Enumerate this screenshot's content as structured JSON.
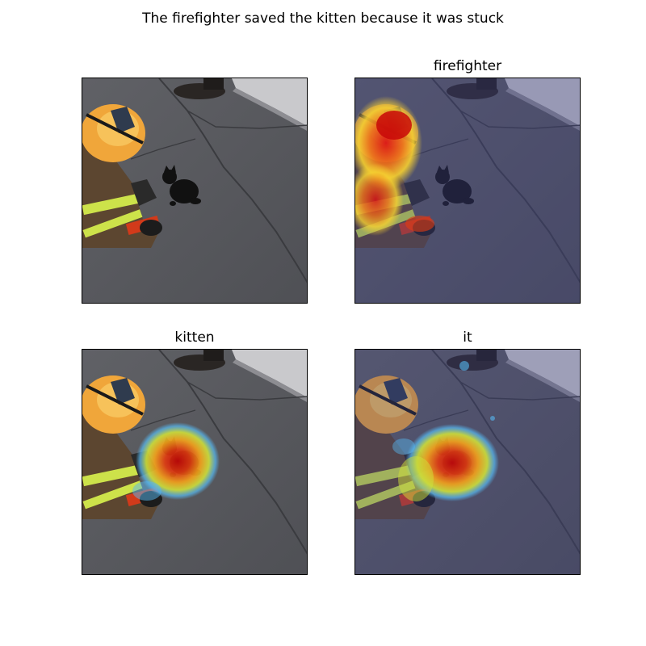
{
  "figure": {
    "suptitle": "The firefighter saved the kitten because it was stuck",
    "panels": [
      {
        "title": "",
        "overlay": "none"
      },
      {
        "title": "firefighter",
        "overlay": "heatmap-on-firefighter"
      },
      {
        "title": "kitten",
        "overlay": "heatmap-on-kitten"
      },
      {
        "title": "it",
        "overlay": "heatmap-on-kitten"
      }
    ]
  },
  "colors": {
    "asphalt": "#5f6064",
    "helmet": "#f0a63a",
    "heat_hot": "#d01010",
    "heat_warm": "#f6a21c",
    "heat_cool": "#4fb6ff",
    "blue_tint": "#3c3e8a"
  }
}
